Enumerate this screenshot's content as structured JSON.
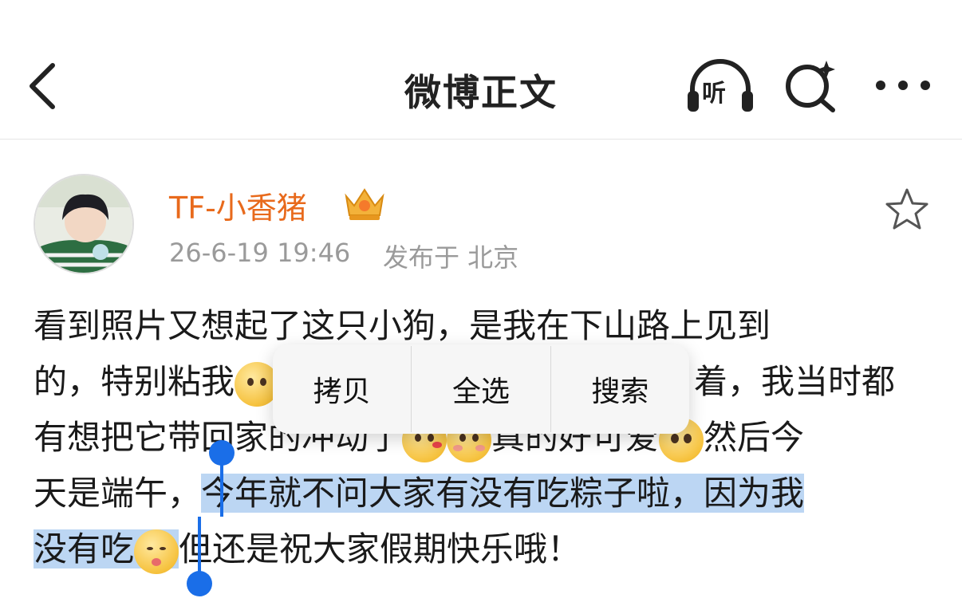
{
  "nav": {
    "title": "微博正文",
    "listen_label": "听",
    "back_icon": "chevron-left-icon",
    "search_icon": "ai-search-icon",
    "more_icon": "more-dots-icon"
  },
  "post": {
    "username": "TF-小香猪",
    "timestamp": "26-6-19 19:46",
    "location": "发布于 北京",
    "colors": {
      "username": "#e86a1c",
      "meta": "#9a9a9a",
      "selection": "#bcd6f3",
      "handle": "#1a6ee8"
    },
    "lines": {
      "l1": "看到照片又想起了这只小狗，是我在下山路上见到",
      "l2a": "的，特别粘我",
      "l2b": "着，我当时都",
      "l3a": "有想把它带回家的冲动了",
      "l3b": "真的好可爱",
      "l3c": "然后今",
      "l4a": "天是端午，",
      "l4b": "今年就不问大家有没有吃粽子啦，因为我",
      "l5a": "没有吃",
      "l5b": "但还是祝大家假期快乐哦！"
    }
  },
  "context_menu": {
    "items": [
      "拷贝",
      "全选",
      "搜索"
    ]
  }
}
